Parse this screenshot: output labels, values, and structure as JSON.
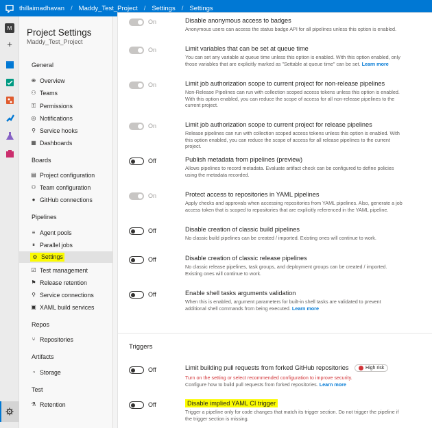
{
  "breadcrumb": [
    "thillaimadhavan",
    "Maddy_Test_Project",
    "Settings",
    "Settings"
  ],
  "rail": {
    "avatar_letter": "M",
    "add": "+"
  },
  "nav": {
    "title": "Project Settings",
    "subtitle": "Maddy_Test_Project",
    "groups": {
      "general": "General",
      "boards": "Boards",
      "pipelines": "Pipelines",
      "repos": "Repos",
      "artifacts": "Artifacts",
      "test": "Test"
    },
    "items": {
      "overview": "Overview",
      "teams": "Teams",
      "permissions": "Permissions",
      "notifications": "Notifications",
      "service_hooks": "Service hooks",
      "dashboards": "Dashboards",
      "project_configuration": "Project configuration",
      "team_configuration": "Team configuration",
      "github_connections": "GitHub connections",
      "agent_pools": "Agent pools",
      "parallel_jobs": "Parallel jobs",
      "settings": "Settings",
      "test_management": "Test management",
      "release_retention": "Release retention",
      "service_connections": "Service connections",
      "xaml_build_services": "XAML build services",
      "repositories": "Repositories",
      "storage": "Storage",
      "retention": "Retention"
    }
  },
  "toggle_labels": {
    "on": "On",
    "off": "Off"
  },
  "general_settings": [
    {
      "state": "on",
      "title": "Disable anonymous access to badges",
      "desc": "Anonymous users can access the status badge API for all pipelines unless this option is enabled."
    },
    {
      "state": "on",
      "title": "Limit variables that can be set at queue time",
      "desc": "You can set any variable at queue time unless this option is enabled. With this option enabled, only those variables that are explicitly marked as \"Settable at queue time\" can be set.",
      "link": "Learn more"
    },
    {
      "state": "on",
      "title": "Limit job authorization scope to current project for non-release pipelines",
      "desc": "Non-Release Pipelines can run with collection scoped access tokens unless this option is enabled. With this option enabled, you can reduce the scope of access for all non-release pipelines to the current project."
    },
    {
      "state": "on",
      "title": "Limit job authorization scope to current project for release pipelines",
      "desc": "Release pipelines can run with collection scoped access tokens unless this option is enabled. With this option enabled, you can reduce the scope of access for all release pipelines to the current project."
    },
    {
      "state": "off",
      "title": "Publish metadata from pipelines (preview)",
      "desc": "Allows pipelines to record metadata. Evaluate artifact check can be configured to define policies using the metadata recorded."
    },
    {
      "state": "on",
      "title": "Protect access to repositories in YAML pipelines",
      "desc": "Apply checks and approvals when accessing repositories from YAML pipelines. Also, generate a job access token that is scoped to repositories that are explicitly referenced in the YAML pipeline."
    },
    {
      "state": "off",
      "title": "Disable creation of classic build pipelines",
      "desc": "No classic build pipelines can be created / imported. Existing ones will continue to work."
    },
    {
      "state": "off",
      "title": "Disable creation of classic release pipelines",
      "desc": "No classic release pipelines, task groups, and deployment groups can be created / imported. Existing ones will continue to work."
    },
    {
      "state": "off",
      "title": "Enable shell tasks arguments validation",
      "desc": "When this is enabled, argument parameters for built-in shell tasks are validated to prevent additional shell commands from being executed.",
      "link": "Learn more"
    }
  ],
  "triggers": {
    "heading": "Triggers",
    "items": [
      {
        "state": "off",
        "title": "Limit building pull requests from forked GitHub repositories",
        "badge": "High risk",
        "warning": "Turn on the setting or select recommended configuration to improve security.",
        "desc": "Configure how to build pull requests from forked repositories.",
        "link": "Learn more"
      },
      {
        "state": "off",
        "title": "Disable implied YAML CI trigger",
        "desc": "Trigger a pipeline only for code changes that match its trigger section. Do not trigger the pipeline if the trigger section is missing."
      }
    ]
  },
  "colors": {
    "accent": "#0078d4",
    "highlight": "#fbfb00",
    "risk": "#d13438"
  }
}
